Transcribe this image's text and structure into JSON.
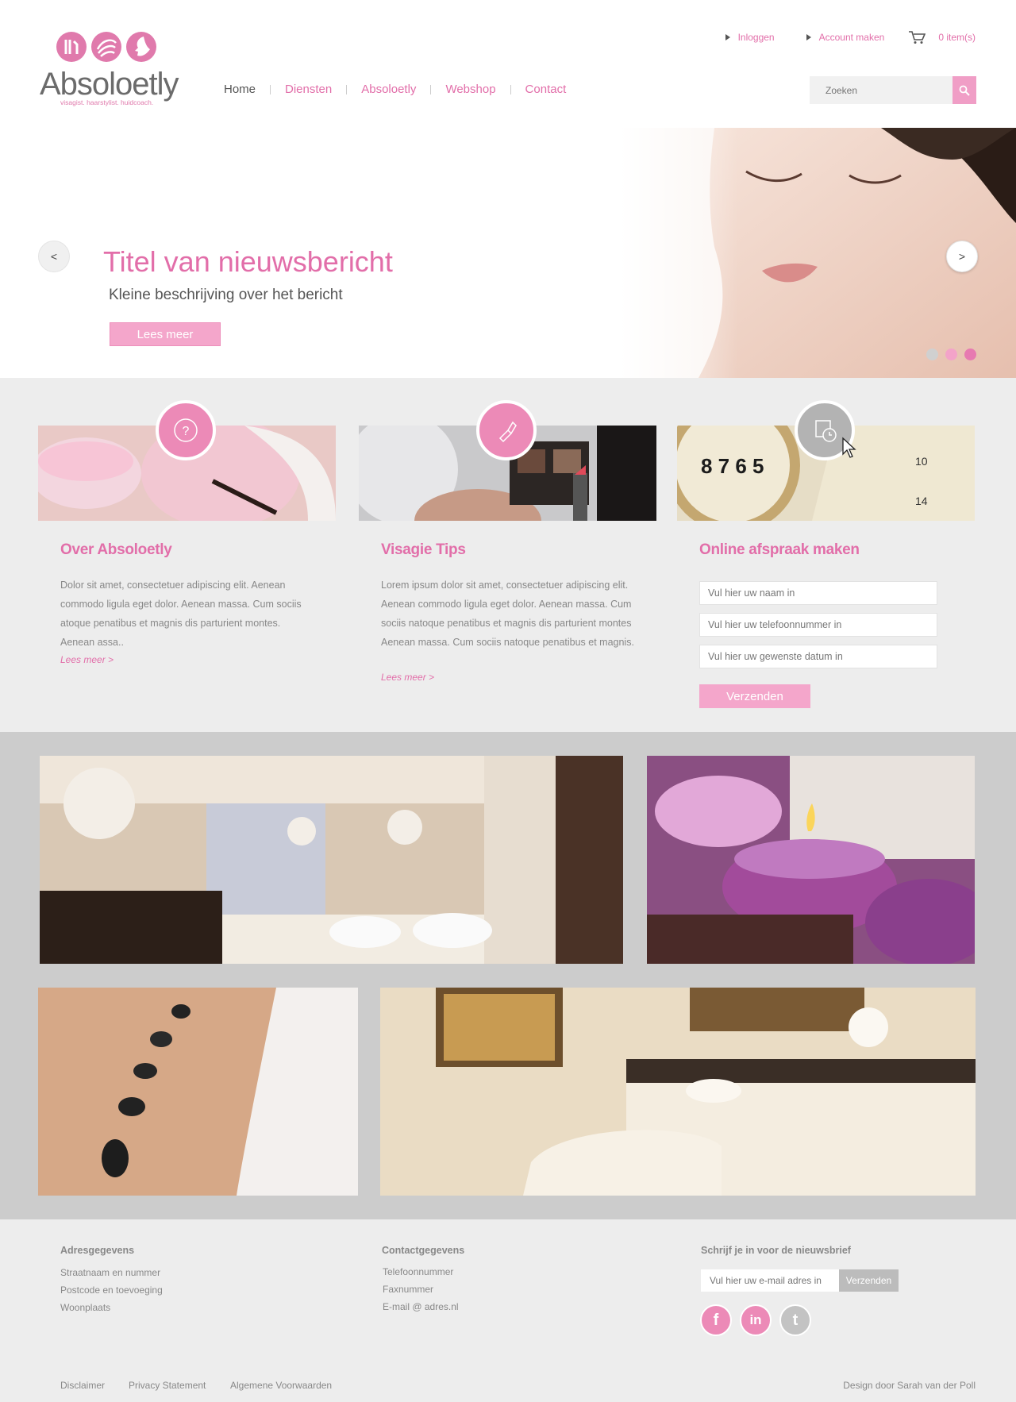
{
  "brand": {
    "name": "Absoloetly",
    "tagline": "visagist. haarstylist. huidcoach.",
    "accent": "#e26ea9",
    "accent_light": "#f4a6cb"
  },
  "topbar": {
    "login": "Inloggen",
    "register": "Account maken",
    "cart_icon": "cart-icon",
    "cart_count": "0 item(s)"
  },
  "nav": {
    "items": [
      {
        "label": "Home",
        "active": true
      },
      {
        "label": "Diensten"
      },
      {
        "label": "Absoloetly"
      },
      {
        "label": "Webshop"
      },
      {
        "label": "Contact"
      }
    ]
  },
  "search": {
    "placeholder": "Zoeken",
    "icon": "search-icon"
  },
  "hero": {
    "title": "Titel van nieuwsbericht",
    "subtitle": "Kleine beschrijving over het bericht",
    "button": "Lees meer",
    "prev": "<",
    "next": ">",
    "slides": 3,
    "active_slide": 3
  },
  "features": [
    {
      "title": "Over Absoloetly",
      "text": "Dolor sit amet, consectetuer adipiscing elit. Aenean commodo ligula eget dolor. Aenean massa. Cum sociis atoque penatibus et magnis dis parturient montes. Aenean assa..",
      "more": "Lees meer >",
      "icon": "question-icon"
    },
    {
      "title": "Visagie Tips",
      "text": "Lorem ipsum dolor sit amet, consectetuer adipiscing elit. Aenean commodo ligula eget dolor. Aenean massa. Cum sociis natoque penatibus et magnis dis parturient montes Aenean massa. Cum sociis natoque penatibus et magnis.",
      "more": "Lees meer >",
      "icon": "lipstick-icon"
    },
    {
      "title": "Online afspraak maken",
      "icon": "calendar-clock-icon",
      "fields": [
        "Vul hier uw naam in",
        "Vul hier uw telefoonnummer in",
        "Vul hier uw gewenste datum in"
      ],
      "button": "Verzenden"
    }
  ],
  "footer": {
    "address": {
      "heading": "Adresgegevens",
      "lines": [
        "Straatnaam en nummer",
        "Postcode en toevoeging",
        "Woonplaats"
      ]
    },
    "contact": {
      "heading": "Contactgegevens",
      "lines": [
        "Telefoonnummer",
        "Faxnummer",
        "E-mail @ adres.nl"
      ]
    },
    "newsletter": {
      "heading": "Schrijf je in voor de nieuwsbrief",
      "placeholder": "Vul hier uw e-mail adres in",
      "button": "Verzenden"
    },
    "social": [
      "facebook-icon",
      "linkedin-icon",
      "twitter-icon"
    ],
    "social_glyphs": [
      "f",
      "in",
      "t"
    ],
    "links": [
      "Disclaimer",
      "Privacy Statement",
      "Algemene Voorwaarden"
    ],
    "credit": "Design door Sarah van der Poll"
  }
}
